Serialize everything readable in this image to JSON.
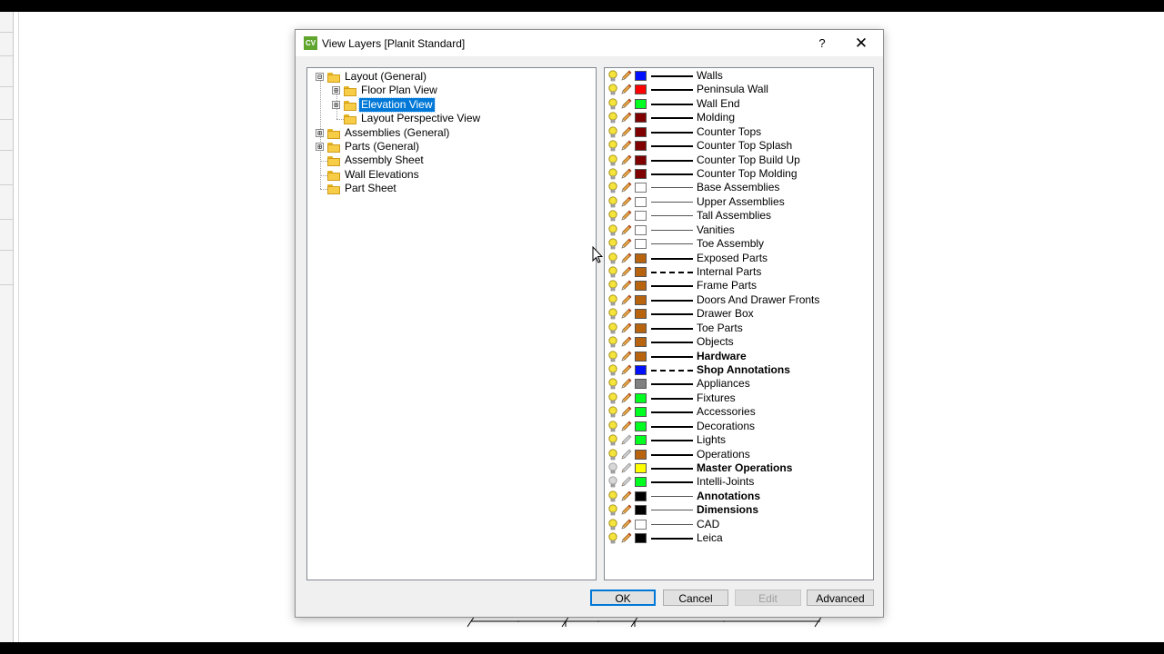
{
  "window": {
    "title": "View Layers [Planit Standard]",
    "app_icon_text": "CV",
    "help_label": "?",
    "close_label": "✕"
  },
  "tree": {
    "items": [
      {
        "label": "Layout (General)",
        "level": 0,
        "expander": "⊟",
        "selected": false
      },
      {
        "label": "Floor Plan View",
        "level": 1,
        "expander": "⊞",
        "selected": false
      },
      {
        "label": "Elevation View",
        "level": 1,
        "expander": "⊞",
        "selected": true
      },
      {
        "label": "Layout Perspective View",
        "level": 1,
        "expander": "",
        "selected": false
      },
      {
        "label": "Assemblies (General)",
        "level": 0,
        "expander": "⊞",
        "selected": false
      },
      {
        "label": "Parts (General)",
        "level": 0,
        "expander": "⊞",
        "selected": false
      },
      {
        "label": "Assembly Sheet",
        "level": 0,
        "expander": "",
        "selected": false
      },
      {
        "label": "Wall Elevations",
        "level": 0,
        "expander": "",
        "selected": false
      },
      {
        "label": "Part Sheet",
        "level": 0,
        "expander": "",
        "selected": false
      }
    ]
  },
  "layers": [
    {
      "label": "Walls",
      "color": "#0010ff",
      "line": "solid",
      "weight": "thick",
      "bold": false,
      "visible": true,
      "editable": true
    },
    {
      "label": "Peninsula Wall",
      "color": "#ff0000",
      "line": "solid",
      "weight": "thick",
      "bold": false,
      "visible": true,
      "editable": true
    },
    {
      "label": "Wall End",
      "color": "#00ff20",
      "line": "solid",
      "weight": "thick",
      "bold": false,
      "visible": true,
      "editable": true
    },
    {
      "label": "Molding",
      "color": "#800000",
      "line": "solid",
      "weight": "thick",
      "bold": false,
      "visible": true,
      "editable": true
    },
    {
      "label": "Counter Tops",
      "color": "#800000",
      "line": "solid",
      "weight": "thick",
      "bold": false,
      "visible": true,
      "editable": true
    },
    {
      "label": "Counter Top Splash",
      "color": "#800000",
      "line": "solid",
      "weight": "thick",
      "bold": false,
      "visible": true,
      "editable": true
    },
    {
      "label": "Counter Top Build Up",
      "color": "#800000",
      "line": "solid",
      "weight": "thick",
      "bold": false,
      "visible": true,
      "editable": true
    },
    {
      "label": "Counter Top Molding",
      "color": "#800000",
      "line": "solid",
      "weight": "thick",
      "bold": false,
      "visible": true,
      "editable": true
    },
    {
      "label": "Base Assemblies",
      "color": "#ffffff",
      "line": "solid",
      "weight": "thin",
      "bold": false,
      "visible": true,
      "editable": true
    },
    {
      "label": "Upper Assemblies",
      "color": "#ffffff",
      "line": "solid",
      "weight": "thin",
      "bold": false,
      "visible": true,
      "editable": true
    },
    {
      "label": "Tall Assemblies",
      "color": "#ffffff",
      "line": "solid",
      "weight": "thin",
      "bold": false,
      "visible": true,
      "editable": true
    },
    {
      "label": "Vanities",
      "color": "#ffffff",
      "line": "solid",
      "weight": "thin",
      "bold": false,
      "visible": true,
      "editable": true
    },
    {
      "label": "Toe Assembly",
      "color": "#ffffff",
      "line": "solid",
      "weight": "thin",
      "bold": false,
      "visible": true,
      "editable": true
    },
    {
      "label": "Exposed Parts",
      "color": "#b8640f",
      "line": "solid",
      "weight": "thick",
      "bold": false,
      "visible": true,
      "editable": true
    },
    {
      "label": "Internal Parts",
      "color": "#b8640f",
      "line": "dashed",
      "weight": "thick",
      "bold": false,
      "visible": true,
      "editable": true
    },
    {
      "label": "Frame Parts",
      "color": "#b8640f",
      "line": "solid",
      "weight": "thick",
      "bold": false,
      "visible": true,
      "editable": true
    },
    {
      "label": "Doors And Drawer Fronts",
      "color": "#b8640f",
      "line": "solid",
      "weight": "thick",
      "bold": false,
      "visible": true,
      "editable": true
    },
    {
      "label": "Drawer Box",
      "color": "#b8640f",
      "line": "solid",
      "weight": "thick",
      "bold": false,
      "visible": true,
      "editable": true
    },
    {
      "label": "Toe Parts",
      "color": "#b8640f",
      "line": "solid",
      "weight": "thick",
      "bold": false,
      "visible": true,
      "editable": true
    },
    {
      "label": "Objects",
      "color": "#b8640f",
      "line": "solid",
      "weight": "thick",
      "bold": false,
      "visible": true,
      "editable": true
    },
    {
      "label": "Hardware",
      "color": "#b8640f",
      "line": "solid",
      "weight": "thick",
      "bold": true,
      "visible": true,
      "editable": true
    },
    {
      "label": "Shop Annotations",
      "color": "#0010ff",
      "line": "dashed",
      "weight": "thick",
      "bold": true,
      "visible": true,
      "editable": true
    },
    {
      "label": "Appliances",
      "color": "#808080",
      "line": "solid",
      "weight": "thick",
      "bold": false,
      "visible": true,
      "editable": true
    },
    {
      "label": "Fixtures",
      "color": "#00ff20",
      "line": "solid",
      "weight": "thick",
      "bold": false,
      "visible": true,
      "editable": true
    },
    {
      "label": "Accessories",
      "color": "#00ff20",
      "line": "solid",
      "weight": "thick",
      "bold": false,
      "visible": true,
      "editable": true
    },
    {
      "label": "Decorations",
      "color": "#00ff20",
      "line": "solid",
      "weight": "thick",
      "bold": false,
      "visible": true,
      "editable": true
    },
    {
      "label": "Lights",
      "color": "#00ff20",
      "line": "solid",
      "weight": "thick",
      "bold": false,
      "visible": true,
      "editable": false
    },
    {
      "label": "Operations",
      "color": "#b8640f",
      "line": "solid",
      "weight": "thick",
      "bold": false,
      "visible": true,
      "editable": false
    },
    {
      "label": "Master Operations",
      "color": "#ffff00",
      "line": "solid",
      "weight": "thick",
      "bold": true,
      "visible": false,
      "editable": false
    },
    {
      "label": "Intelli-Joints",
      "color": "#00ff20",
      "line": "solid",
      "weight": "thick",
      "bold": false,
      "visible": false,
      "editable": false
    },
    {
      "label": "Annotations",
      "color": "#000000",
      "line": "solid",
      "weight": "thin",
      "bold": true,
      "visible": true,
      "editable": true
    },
    {
      "label": "Dimensions",
      "color": "#000000",
      "line": "solid",
      "weight": "thin",
      "bold": true,
      "visible": true,
      "editable": true
    },
    {
      "label": "CAD",
      "color": "#ffffff",
      "line": "solid",
      "weight": "thin",
      "bold": false,
      "visible": true,
      "editable": true
    },
    {
      "label": "Leica",
      "color": "#000000",
      "line": "solid",
      "weight": "thick",
      "bold": false,
      "visible": true,
      "editable": true
    }
  ],
  "buttons": {
    "ok": "OK",
    "cancel": "Cancel",
    "edit": "Edit",
    "advanced": "Advanced"
  }
}
